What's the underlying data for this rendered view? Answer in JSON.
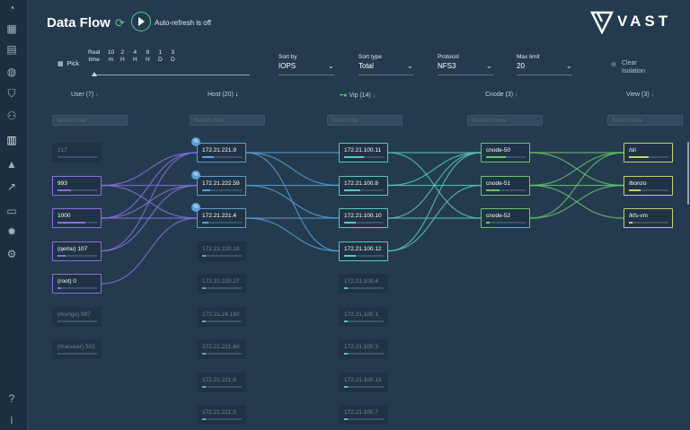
{
  "app": {
    "title": "Data Flow",
    "auto_refresh": "Auto-refresh is off",
    "logo": "VAST"
  },
  "sidebar": {
    "icons": [
      "dashboard-icon",
      "grid-icon",
      "files-icon",
      "globe-icon",
      "shield-icon",
      "users-icon",
      "analytics-icon",
      "alert-icon",
      "trend-icon",
      "storage-icon",
      "settings-icon",
      "user-settings-icon",
      "help-icon",
      "info-icon"
    ]
  },
  "toolbar": {
    "pick": "Pick",
    "times": [
      {
        "top": "Real",
        "bottom": "time"
      },
      {
        "top": "10",
        "bottom": "m"
      },
      {
        "top": "2",
        "bottom": "H"
      },
      {
        "top": "4",
        "bottom": "H"
      },
      {
        "top": "8",
        "bottom": "H"
      },
      {
        "top": "1",
        "bottom": "D"
      },
      {
        "top": "3",
        "bottom": "D"
      }
    ],
    "sort_by": {
      "label": "Sort by",
      "value": "IOPS"
    },
    "sort_type": {
      "label": "Sort type",
      "value": "Total"
    },
    "protocol": {
      "label": "Protocol",
      "value": "NFS3"
    },
    "max_limit": {
      "label": "Max limit",
      "value": "20"
    },
    "clear_isolation": "Clear\nIsolation"
  },
  "columns": {
    "user": {
      "label": "User (7)",
      "search": "Search User"
    },
    "host": {
      "label": "Host (20)",
      "search": "Search Host"
    },
    "vip": {
      "label": "Vip (14)",
      "search": "Search Vip"
    },
    "cnode": {
      "label": "Cnode (3)",
      "search": "Search Cnode"
    },
    "view": {
      "label": "View (3)",
      "search": "Search View"
    }
  },
  "users": [
    {
      "label": "217",
      "active": false,
      "fill": 0.0
    },
    {
      "label": "993",
      "active": true,
      "fill": 0.35
    },
    {
      "label": "1000",
      "active": true,
      "fill": 0.7
    },
    {
      "label": "(qemu) 107",
      "active": true,
      "fill": 0.2
    },
    {
      "label": "(root) 0",
      "active": true,
      "fill": 0.1
    },
    {
      "label": "(mungo) 997",
      "active": false,
      "fill": 0.0
    },
    {
      "label": "(macuser) 501",
      "active": false,
      "fill": 0.0
    }
  ],
  "hosts": [
    {
      "label": "172.21.221.9",
      "active": true,
      "fill": 0.3
    },
    {
      "label": "172.21.222.59",
      "active": true,
      "fill": 0.2
    },
    {
      "label": "172.21.221.4",
      "active": true,
      "fill": 0.15
    },
    {
      "label": "172.21.220.18",
      "active": false,
      "fill": 0.1
    },
    {
      "label": "172.21.220.27",
      "active": false,
      "fill": 0.1
    },
    {
      "label": "172.21.24.160",
      "active": false,
      "fill": 0.1
    },
    {
      "label": "172.21.221.60",
      "active": false,
      "fill": 0.1
    },
    {
      "label": "172.21.221.6",
      "active": false,
      "fill": 0.1
    },
    {
      "label": "172.21.221.5",
      "active": false,
      "fill": 0.1
    }
  ],
  "vips": [
    {
      "label": "172.21.100.11",
      "active": true,
      "fill": 0.5
    },
    {
      "label": "172.21.100.8",
      "active": true,
      "fill": 0.4
    },
    {
      "label": "172.21.100.10",
      "active": true,
      "fill": 0.3
    },
    {
      "label": "172.21.100.12",
      "active": true,
      "fill": 0.3
    },
    {
      "label": "172.21.100.4",
      "active": false,
      "fill": 0.1
    },
    {
      "label": "172.21.100.1",
      "active": false,
      "fill": 0.1
    },
    {
      "label": "172.21.100.3",
      "active": false,
      "fill": 0.1
    },
    {
      "label": "172.21.100.13",
      "active": false,
      "fill": 0.1
    },
    {
      "label": "172.21.100.7",
      "active": false,
      "fill": 0.1
    }
  ],
  "cnodes": [
    {
      "label": "cnode-50",
      "active": true,
      "fill": 0.5
    },
    {
      "label": "cnode-51",
      "active": true,
      "fill": 0.35
    },
    {
      "label": "cnode-52",
      "active": true,
      "fill": 0.1
    }
  ],
  "views": [
    {
      "label": "/sli",
      "active": true,
      "fill": 0.5
    },
    {
      "label": "/bonzo",
      "active": true,
      "fill": 0.3
    },
    {
      "label": "/kfs-vm",
      "active": true,
      "fill": 0.1
    }
  ],
  "colors": {
    "user": "#8a6fe0",
    "host": "#5a9fd6",
    "vip": "#58c8c0",
    "cnode": "#6cc46c",
    "view": "#c9cf6a"
  }
}
